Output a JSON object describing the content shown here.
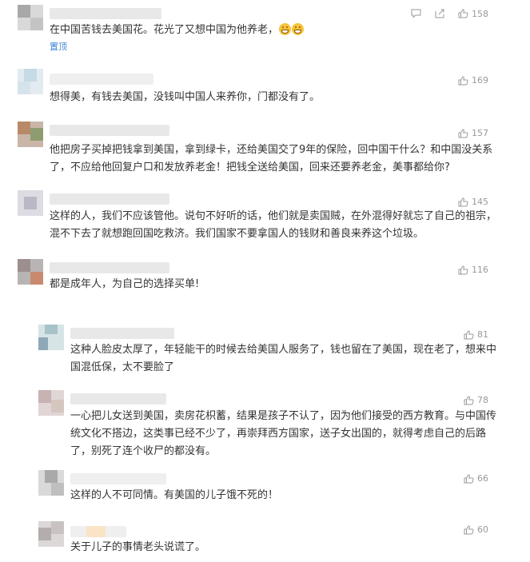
{
  "comments": [
    {
      "text": "在中国苦钱去美国花。花光了又想中国为他养老，",
      "tag": "置顶",
      "likes": "158"
    },
    {
      "text": "想得美，有钱去美国，没钱叫中国人来养你，门都没有了。",
      "likes": "169"
    },
    {
      "text": "他把房子买掉把钱拿到美国，拿到绿卡，还给美国交了9年的保险，回中国干什么？和中国没关系了，不应给他回复户口和发放养老金！把钱全送给美国，回来还要养老金，美事都给你?",
      "likes": "157"
    },
    {
      "text": "这样的人，我们不应该管他。说句不好听的话，他们就是卖国贼，在外混得好就忘了自己的祖宗，混不下去了就想跑回国吃救济。我们国家不要拿国人的钱财和善良来养这个垃圾。",
      "likes": "145"
    },
    {
      "text": "都是成年人，为自己的选择买单!",
      "likes": "116"
    }
  ],
  "replies": [
    {
      "text": "这种人脸皮太厚了，年轻能干的时候去给美国人服务了，钱也留在了美国，现在老了，想来中国混低保，太不要脸了",
      "likes": "81"
    },
    {
      "text": "一心把儿女送到美国，卖房花枳蓄，结果是孩子不认了，因为他们接受的西方教育。与中国传统文化不搭边，这类事已经不少了，再崇拜西方国家，送子女出国的，就得考虑自己的后路了，别死了连个收尸的都没有。",
      "likes": "78"
    },
    {
      "text": "这样的人不可同情。有美国的儿子饿不死的！",
      "likes": "66"
    },
    {
      "text": "关于儿子的事情老头说谎了。",
      "likes": "60"
    }
  ],
  "icons": {
    "reply": "comment-icon",
    "share": "share-icon",
    "like": "thumbs-up-icon",
    "emoji": "grin-emoji-icon"
  },
  "colors": {
    "text": "#333333",
    "meta": "#999999",
    "pin": "#3d86d6"
  }
}
